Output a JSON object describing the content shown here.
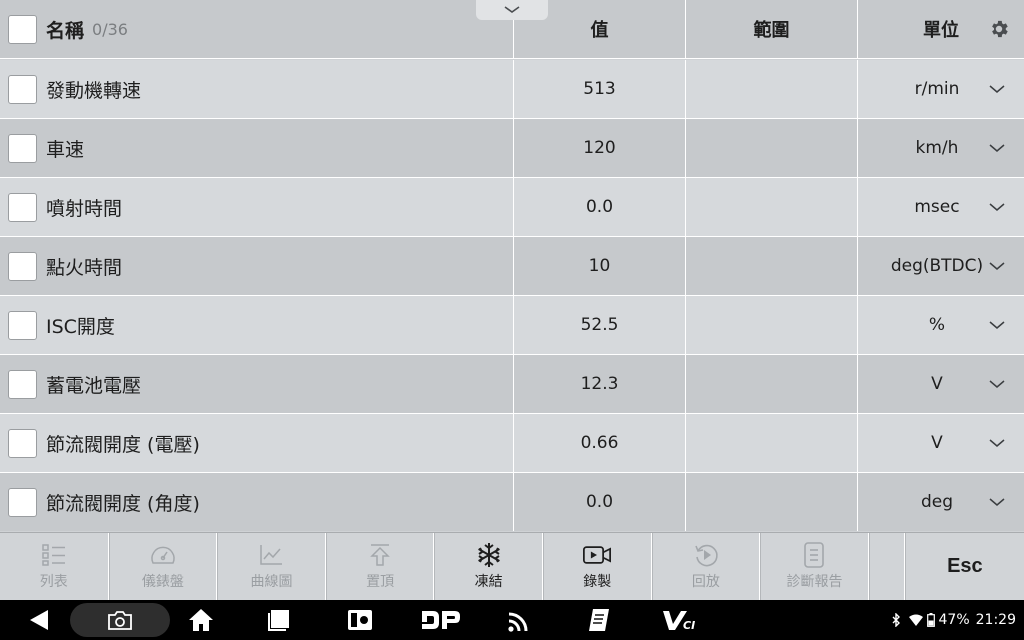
{
  "header": {
    "title": "名稱",
    "count": "0/36",
    "col_value": "值",
    "col_range": "範圍",
    "col_unit": "單位"
  },
  "rows": [
    {
      "name": "發動機轉速",
      "value": "513",
      "range": "",
      "unit": "r/min"
    },
    {
      "name": "車速",
      "value": "120",
      "range": "",
      "unit": "km/h"
    },
    {
      "name": "噴射時間",
      "value": "0.0",
      "range": "",
      "unit": "msec"
    },
    {
      "name": "點火時間",
      "value": "10",
      "range": "",
      "unit": "deg(BTDC)"
    },
    {
      "name": "ISC開度",
      "value": "52.5",
      "range": "",
      "unit": "%"
    },
    {
      "name": "蓄電池電壓",
      "value": "12.3",
      "range": "",
      "unit": "V"
    },
    {
      "name": "節流閥開度 (電壓)",
      "value": "0.66",
      "range": "",
      "unit": "V"
    },
    {
      "name": "節流閥開度 (角度)",
      "value": "0.0",
      "range": "",
      "unit": "deg"
    }
  ],
  "toolbar": {
    "list": "列表",
    "dashboard": "儀錶盤",
    "graph": "曲線圖",
    "pin_top": "置頂",
    "freeze": "凍結",
    "record": "錄製",
    "playback": "回放",
    "report": "診斷報告",
    "esc": "Esc"
  },
  "status": {
    "battery": "47%",
    "time": "21:29"
  },
  "colors": {
    "row_light": "#d6d9dc",
    "row_dark": "#c6c9cc",
    "disabled_text": "#9a9ea2"
  }
}
